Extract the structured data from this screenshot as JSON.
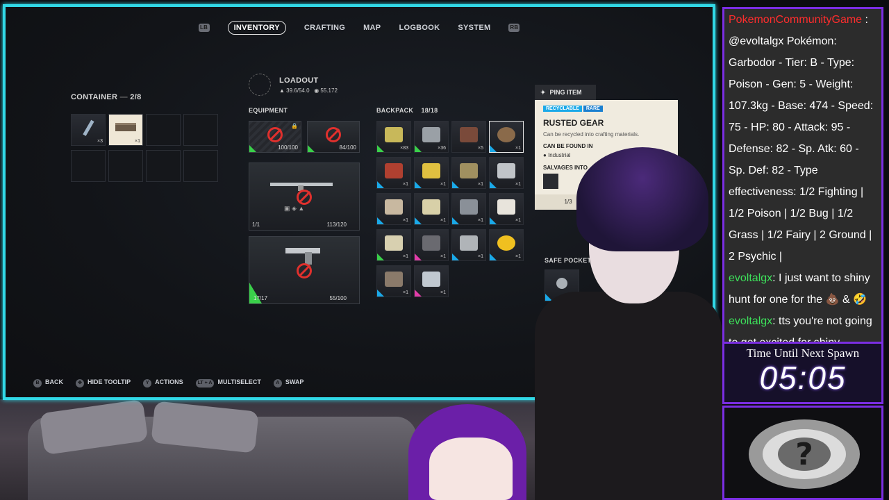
{
  "nav": {
    "left_bumper": "LB",
    "right_bumper": "RB",
    "tabs": [
      "INVENTORY",
      "CRAFTING",
      "MAP",
      "LOGBOOK",
      "SYSTEM"
    ]
  },
  "container": {
    "title": "CONTAINER",
    "count": "2/8",
    "slot1_qty": "×3",
    "slot2_qty": "×1"
  },
  "loadout": {
    "title": "LOADOUT",
    "weight": "39.6/54.0",
    "value": "55.172"
  },
  "equipment": {
    "label": "EQUIPMENT",
    "shield_durability": "100/100",
    "augment_durability": "84/100",
    "weapon1_ammo": "1/1",
    "weapon1_durability": "113/120",
    "weapon2_ammo": "17/17",
    "weapon2_durability": "55/100"
  },
  "backpack": {
    "label": "BACKPACK",
    "count": "18/18",
    "qty": [
      "×83",
      "×36",
      "×5",
      "×1",
      "×1",
      "×1",
      "×1",
      "×1",
      "×1",
      "×1",
      "×1",
      "×1",
      "×1",
      "×1",
      "×1",
      "×1",
      "×1",
      "×1"
    ]
  },
  "safe_pocket": {
    "label": "SAFE POCKET"
  },
  "tooltip": {
    "ping": "PING ITEM",
    "tag1": "RECYCLABLE",
    "tag2": "RARE",
    "name": "RUSTED GEAR",
    "desc": "Can be recycled into crafting materials.",
    "found_label": "CAN BE FOUND IN",
    "found_value": "Industrial",
    "salvage_label": "SALVAGES INTO",
    "page": "1/3"
  },
  "hints": [
    {
      "key": "B",
      "label": "BACK"
    },
    {
      "key": "✥",
      "label": "HIDE TOOLTIP"
    },
    {
      "key": "Y",
      "label": "ACTIONS"
    },
    {
      "key": "LT + A",
      "label": "MULTISELECT"
    },
    {
      "key": "A",
      "label": "SWAP"
    }
  ],
  "chat": {
    "line0_user": "PokemonCommunityGame",
    "line0_text": "@evoltalgx Pokémon: Garbodor - Tier: B - Type: Poison - Gen: 5 - Weight: 107.3kg - Base: 474 - Speed: 75 - HP: 80 - Attack: 95 - Defense: 82 - Sp. Atk: 60 - Sp. Def: 82 - Type effectiveness: 1/2 Fighting | 1/2 Poison | 1/2 Bug | 1/2 Grass | 1/2 Fairy | 2 Ground | 2 Psychic |",
    "line1_user": "evoltalgx",
    "line1_text": ": I just want to shiny hunt for one for the 💩 & 🤣",
    "line2_user": "evoltalgx",
    "line2_text": ": tts you're not going to get excited for shiny garbage"
  },
  "timer": {
    "label": "Time Until Next Spawn",
    "value": "05:05"
  },
  "colors": {
    "frame": "#31d8e6",
    "accent": "#7b2ee3",
    "rarity_green": "#3ad04a",
    "rarity_blue": "#1aa9e8",
    "rarity_pink": "#e23ca8",
    "forbid": "#e0302d"
  }
}
